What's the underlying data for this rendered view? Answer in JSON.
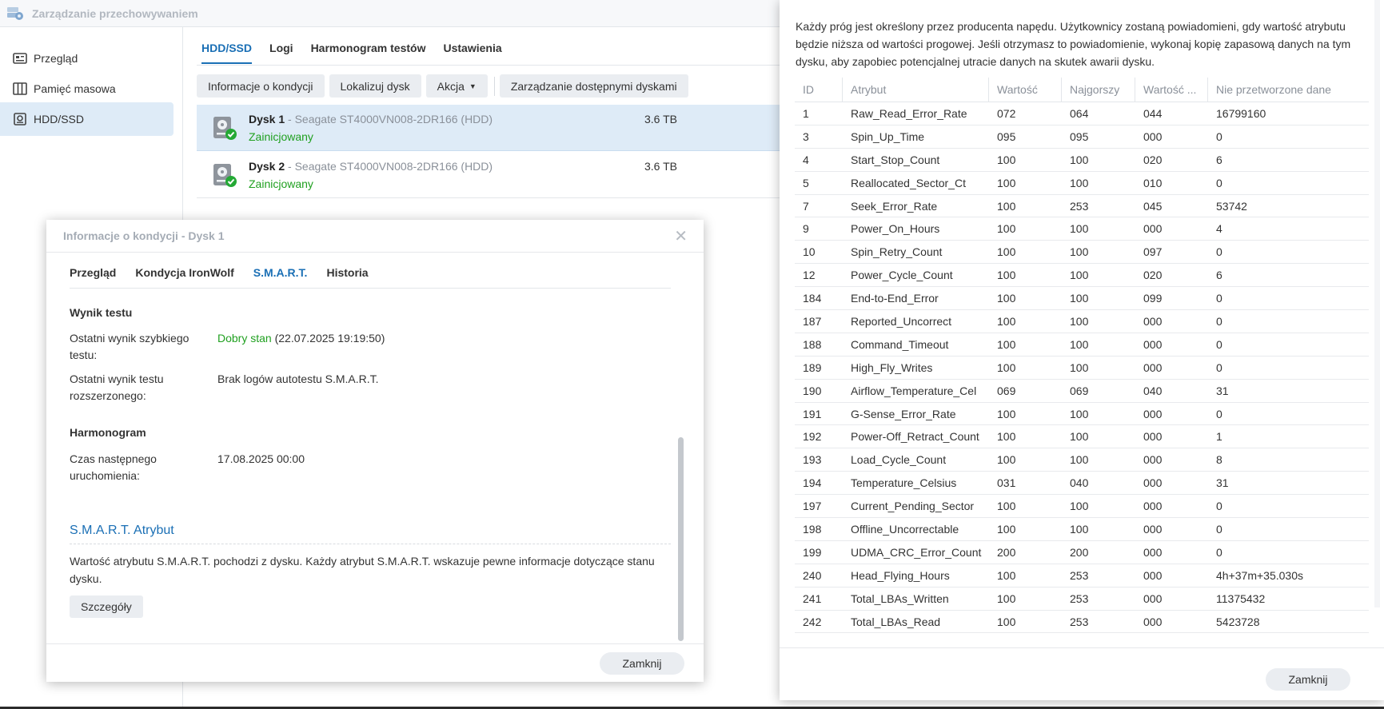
{
  "app": {
    "title": "Zarządzanie przechowywaniem",
    "icon": "storage-manager-icon"
  },
  "sidebar": {
    "items": [
      {
        "label": "Przegląd",
        "icon": "overview-icon"
      },
      {
        "label": "Pamięć masowa",
        "icon": "storage-icon"
      },
      {
        "label": "HDD/SSD",
        "icon": "disk-icon",
        "active": true
      }
    ]
  },
  "main": {
    "tabs": [
      {
        "label": "HDD/SSD",
        "active": true
      },
      {
        "label": "Logi"
      },
      {
        "label": "Harmonogram testów"
      },
      {
        "label": "Ustawienia"
      }
    ],
    "toolbar": {
      "health_info": "Informacje o kondycji",
      "locate": "Lokalizuj dysk",
      "action": "Akcja",
      "manage": "Zarządzanie dostępnymi dyskami"
    },
    "disks": [
      {
        "name": "Dysk 1",
        "model": " - Seagate ST4000VN008-2DR166 (HDD)",
        "status": "Zainicjowany",
        "size": "3.6 TB"
      },
      {
        "name": "Dysk 2",
        "model": " - Seagate ST4000VN008-2DR166 (HDD)",
        "status": "Zainicjowany",
        "size": "3.6 TB"
      }
    ]
  },
  "health_dialog": {
    "title": "Informacje o kondycji - Dysk 1",
    "tabs": [
      "Przegląd",
      "Kondycja IronWolf",
      "S.M.A.R.T.",
      "Historia"
    ],
    "active_tab": "S.M.A.R.T.",
    "test_result": {
      "heading": "Wynik testu",
      "quick_label": "Ostatni wynik szybkiego testu:",
      "quick_status": "Dobry stan",
      "quick_date": " (22.07.2025 19:19:50)",
      "extended_label": "Ostatni wynik testu rozszerzonego:",
      "extended_value": "Brak logów autotestu S.M.A.R.T."
    },
    "schedule": {
      "heading": "Harmonogram",
      "next_label": "Czas następnego uruchomienia:",
      "next_value": "17.08.2025 00:00"
    },
    "smart_attr": {
      "heading": "S.M.A.R.T. Atrybut",
      "description": "Wartość atrybutu S.M.A.R.T. pochodzi z dysku. Każdy atrybut S.M.A.R.T. wskazuje pewne informacje dotyczące stanu dysku.",
      "details_button": "Szczegóły"
    },
    "close_button": "Zamknij"
  },
  "attributes_dialog": {
    "description": "Każdy próg jest określony przez producenta napędu. Użytkownicy zostaną powiadomieni, gdy wartość atrybutu będzie niższa od wartości progowej. Jeśli otrzymasz to powiadomienie, wykonaj kopię zapasową danych na tym dysku, aby zapobiec potencjalnej utracie danych na skutek awarii dysku.",
    "columns": [
      "ID",
      "Atrybut",
      "Wartość",
      "Najgorszy",
      "Wartość ...",
      "Nie przetworzone dane"
    ],
    "rows": [
      [
        "1",
        "Raw_Read_Error_Rate",
        "072",
        "064",
        "044",
        "16799160"
      ],
      [
        "3",
        "Spin_Up_Time",
        "095",
        "095",
        "000",
        "0"
      ],
      [
        "4",
        "Start_Stop_Count",
        "100",
        "100",
        "020",
        "6"
      ],
      [
        "5",
        "Reallocated_Sector_Ct",
        "100",
        "100",
        "010",
        "0"
      ],
      [
        "7",
        "Seek_Error_Rate",
        "100",
        "253",
        "045",
        "53742"
      ],
      [
        "9",
        "Power_On_Hours",
        "100",
        "100",
        "000",
        "4"
      ],
      [
        "10",
        "Spin_Retry_Count",
        "100",
        "100",
        "097",
        "0"
      ],
      [
        "12",
        "Power_Cycle_Count",
        "100",
        "100",
        "020",
        "6"
      ],
      [
        "184",
        "End-to-End_Error",
        "100",
        "100",
        "099",
        "0"
      ],
      [
        "187",
        "Reported_Uncorrect",
        "100",
        "100",
        "000",
        "0"
      ],
      [
        "188",
        "Command_Timeout",
        "100",
        "100",
        "000",
        "0"
      ],
      [
        "189",
        "High_Fly_Writes",
        "100",
        "100",
        "000",
        "0"
      ],
      [
        "190",
        "Airflow_Temperature_Cel",
        "069",
        "069",
        "040",
        "31"
      ],
      [
        "191",
        "G-Sense_Error_Rate",
        "100",
        "100",
        "000",
        "0"
      ],
      [
        "192",
        "Power-Off_Retract_Count",
        "100",
        "100",
        "000",
        "1"
      ],
      [
        "193",
        "Load_Cycle_Count",
        "100",
        "100",
        "000",
        "8"
      ],
      [
        "194",
        "Temperature_Celsius",
        "031",
        "040",
        "000",
        "31"
      ],
      [
        "197",
        "Current_Pending_Sector",
        "100",
        "100",
        "000",
        "0"
      ],
      [
        "198",
        "Offline_Uncorrectable",
        "100",
        "100",
        "000",
        "0"
      ],
      [
        "199",
        "UDMA_CRC_Error_Count",
        "200",
        "200",
        "000",
        "0"
      ],
      [
        "240",
        "Head_Flying_Hours",
        "100",
        "253",
        "000",
        "4h+37m+35.030s"
      ],
      [
        "241",
        "Total_LBAs_Written",
        "100",
        "253",
        "000",
        "11375432"
      ],
      [
        "242",
        "Total_LBAs_Read",
        "100",
        "253",
        "000",
        "5423728"
      ]
    ],
    "close_button": "Zamknij"
  },
  "colors": {
    "accent": "#1a6fb5",
    "good": "#20a020",
    "selection": "#deebf7"
  }
}
